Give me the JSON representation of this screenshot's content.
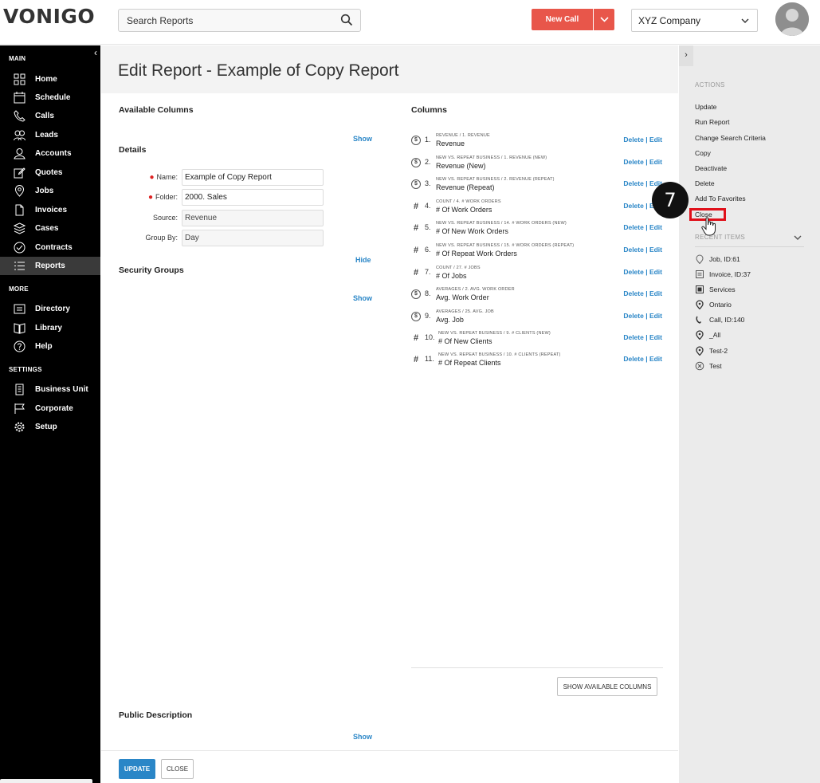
{
  "app": {
    "logo": "VONIGO"
  },
  "header": {
    "search_placeholder": "Search Reports",
    "new_call_label": "New Call",
    "company": "XYZ Company",
    "colors": {
      "accent": "#e8564a",
      "link": "#2a86c7"
    }
  },
  "sidebar": {
    "sections": {
      "main": "MAIN",
      "more": "MORE",
      "settings": "SETTINGS"
    },
    "main_items": [
      {
        "label": "Home",
        "icon": "home-icon"
      },
      {
        "label": "Schedule",
        "icon": "calendar-icon"
      },
      {
        "label": "Calls",
        "icon": "phone-icon"
      },
      {
        "label": "Leads",
        "icon": "leads-icon"
      },
      {
        "label": "Accounts",
        "icon": "user-icon"
      },
      {
        "label": "Quotes",
        "icon": "edit-icon"
      },
      {
        "label": "Jobs",
        "icon": "pin-icon"
      },
      {
        "label": "Invoices",
        "icon": "document-icon"
      },
      {
        "label": "Cases",
        "icon": "layers-icon"
      },
      {
        "label": "Contracts",
        "icon": "check-circle-icon"
      },
      {
        "label": "Reports",
        "icon": "list-icon"
      }
    ],
    "more_items": [
      {
        "label": "Directory",
        "icon": "directory-icon"
      },
      {
        "label": "Library",
        "icon": "book-icon"
      },
      {
        "label": "Help",
        "icon": "help-icon"
      }
    ],
    "settings_items": [
      {
        "label": "Business Unit",
        "icon": "building-icon"
      },
      {
        "label": "Corporate",
        "icon": "flag-icon"
      },
      {
        "label": "Setup",
        "icon": "gear-icon"
      }
    ]
  },
  "main": {
    "title": "Edit Report - Example of Copy Report",
    "available_columns": "Available Columns",
    "show": "Show",
    "hide": "Hide",
    "details": "Details",
    "fields": {
      "name_label": "Name:",
      "name_value": "Example of Copy Report",
      "folder_label": "Folder:",
      "folder_value": "2000. Sales",
      "source_label": "Source:",
      "source_value": "Revenue",
      "groupby_label": "Group By:",
      "groupby_value": "Day"
    },
    "security_groups": "Security Groups",
    "public_description": "Public Description",
    "columns_heading": "Columns",
    "columns": [
      {
        "num": "1.",
        "type": "money",
        "sub": "REVENUE / 1. REVENUE",
        "name": "Revenue",
        "actions": "Delete | Edit"
      },
      {
        "num": "2.",
        "type": "money",
        "sub": "NEW VS. REPEAT BUSINESS / 1. REVENUE (NEW)",
        "name": "Revenue (New)",
        "actions": "Delete | Edit"
      },
      {
        "num": "3.",
        "type": "money",
        "sub": "NEW VS. REPEAT BUSINESS / 2. REVENUE (REPEAT)",
        "name": "Revenue (Repeat)",
        "actions": "Delete | Edit"
      },
      {
        "num": "4.",
        "type": "count",
        "sub": "COUNT / 4. # WORK ORDERS",
        "name": "# Of Work Orders",
        "actions": "Delete | Edit"
      },
      {
        "num": "5.",
        "type": "count",
        "sub": "NEW VS. REPEAT BUSINESS / 14. # WORK ORDERS (NEW)",
        "name": "# Of New Work Orders",
        "actions": "Delete | Edit"
      },
      {
        "num": "6.",
        "type": "count",
        "sub": "NEW VS. REPEAT BUSINESS / 15. # WORK ORDERS (REPEAT)",
        "name": "# Of Repeat Work Orders",
        "actions": "Delete | Edit"
      },
      {
        "num": "7.",
        "type": "count",
        "sub": "COUNT / 27. # JOBS",
        "name": "# Of Jobs",
        "actions": "Delete | Edit"
      },
      {
        "num": "8.",
        "type": "money",
        "sub": "AVERAGES / 2. AVG. WORK ORDER",
        "name": "Avg. Work Order",
        "actions": "Delete | Edit"
      },
      {
        "num": "9.",
        "type": "money",
        "sub": "AVERAGES / 25. AVG. JOB",
        "name": "Avg. Job",
        "actions": "Delete | Edit"
      },
      {
        "num": "10.",
        "type": "count",
        "sub": "NEW VS. REPEAT BUSINESS / 9. # CLIENTS (NEW)",
        "name": "# Of New Clients",
        "actions": "Delete | Edit"
      },
      {
        "num": "11.",
        "type": "count",
        "sub": "NEW VS. REPEAT BUSINESS / 10. # CLIENTS (REPEAT)",
        "name": "# Of Repeat Clients",
        "actions": "Delete | Edit"
      }
    ],
    "show_available_columns": "SHOW AVAILABLE COLUMNS",
    "update_button": "UPDATE",
    "close_button": "CLOSE"
  },
  "right_panel": {
    "actions_heading": "ACTIONS",
    "actions": [
      "Update",
      "Run Report",
      "Change Search Criteria",
      "Copy",
      "Deactivate",
      "Delete",
      "Add To Favorites",
      "Close"
    ],
    "recent_heading": "RECENT ITEMS",
    "recent": [
      {
        "label": "Job, ID:61",
        "icon": "pin-icon"
      },
      {
        "label": "Invoice, ID:37",
        "icon": "invoice-icon"
      },
      {
        "label": "Services",
        "icon": "services-icon"
      },
      {
        "label": "Ontario",
        "icon": "location-icon"
      },
      {
        "label": "Call, ID:140",
        "icon": "phone-icon"
      },
      {
        "label": "_All",
        "icon": "location-icon"
      },
      {
        "label": "Test-2",
        "icon": "location-icon"
      },
      {
        "label": "Test",
        "icon": "cancel-icon"
      }
    ]
  },
  "annotation": {
    "step": "7"
  }
}
